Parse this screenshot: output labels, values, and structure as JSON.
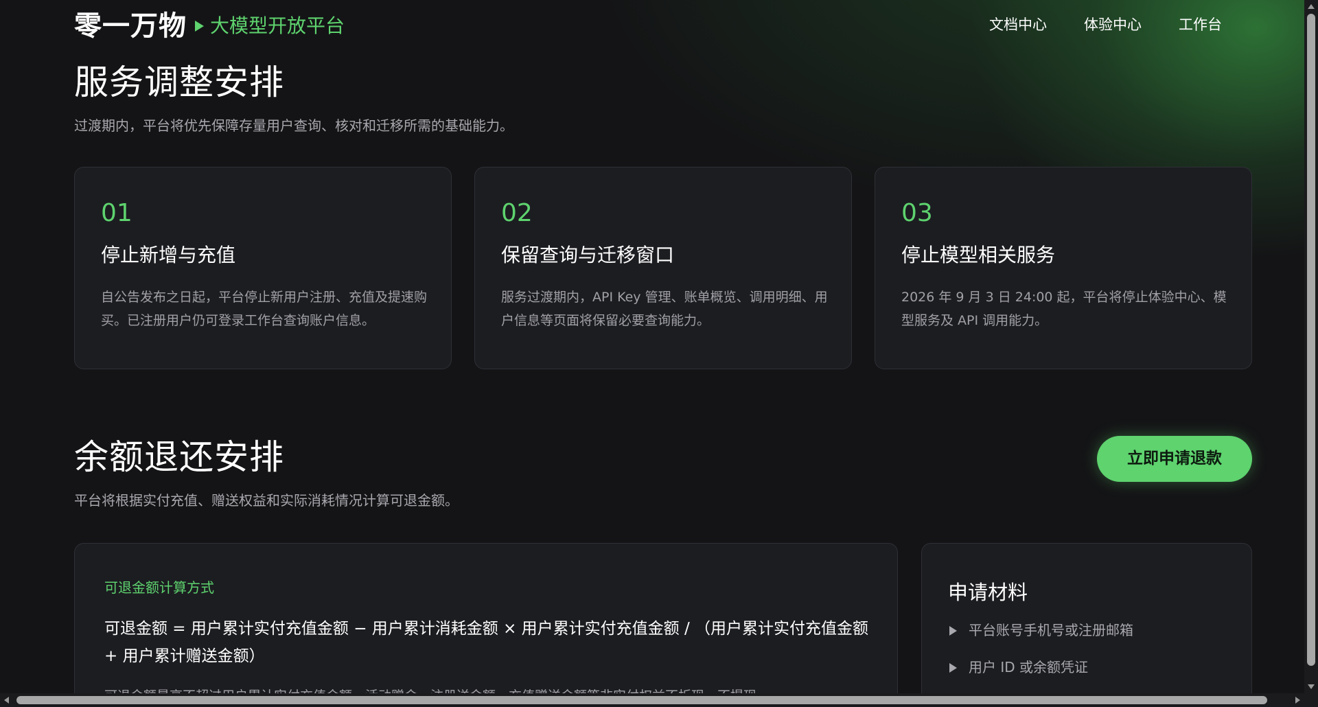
{
  "header": {
    "logo": "零一万物",
    "platform": "大模型开放平台",
    "nav": [
      "文档中心",
      "体验中心",
      "工作台"
    ]
  },
  "service": {
    "title": "服务调整安排",
    "desc": "过渡期内，平台将优先保障存量用户查询、核对和迁移所需的基础能力。",
    "cards": [
      {
        "num": "01",
        "title": "停止新增与充值",
        "desc": "自公告发布之日起，平台停止新用户注册、充值及提速购买。已注册用户仍可登录工作台查询账户信息。"
      },
      {
        "num": "02",
        "title": "保留查询与迁移窗口",
        "desc": "服务过渡期内，API Key 管理、账单概览、调用明细、用户信息等页面将保留必要查询能力。"
      },
      {
        "num": "03",
        "title": "停止模型相关服务",
        "desc": "2026 年 9 月 3 日 24:00 起，平台将停止体验中心、模型服务及 API 调用能力。"
      }
    ]
  },
  "refund": {
    "title": "余额退还安排",
    "desc": "平台将根据实付充值、赠送权益和实际消耗情况计算可退金额。",
    "button": "立即申请退款",
    "formula_label": "可退金额计算方式",
    "formula": "可退金额 = 用户累计实付充值金额 − 用户累计消耗金额 × 用户累计实付充值金额 / （用户累计实付充值金额 + 用户累计赠送金额）",
    "note": "可退金额最高不超过用户累计实付充值金额，活动赠金、注册送金额、充值赠送金额等非实付权益不折现、不提现。",
    "materials_title": "申请材料",
    "materials": [
      "平台账号手机号或注册邮箱",
      "用户 ID 或余额凭证"
    ]
  },
  "colors": {
    "accent": "#5ed36e",
    "background": "#141416",
    "card": "#1c1d21"
  }
}
